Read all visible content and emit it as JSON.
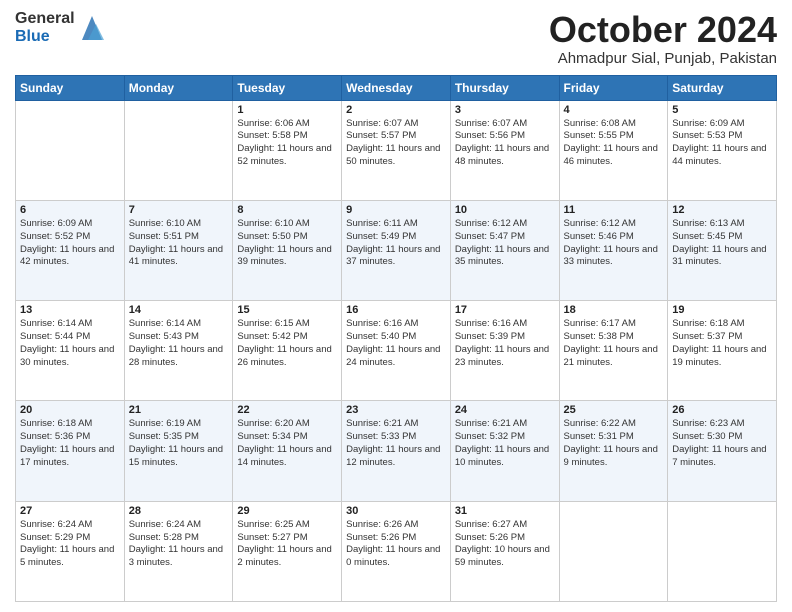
{
  "logo": {
    "line1": "General",
    "line2": "Blue"
  },
  "header": {
    "month": "October 2024",
    "location": "Ahmadpur Sial, Punjab, Pakistan"
  },
  "days_of_week": [
    "Sunday",
    "Monday",
    "Tuesday",
    "Wednesday",
    "Thursday",
    "Friday",
    "Saturday"
  ],
  "weeks": [
    [
      {
        "day": "",
        "sunrise": "",
        "sunset": "",
        "daylight": ""
      },
      {
        "day": "",
        "sunrise": "",
        "sunset": "",
        "daylight": ""
      },
      {
        "day": "1",
        "sunrise": "Sunrise: 6:06 AM",
        "sunset": "Sunset: 5:58 PM",
        "daylight": "Daylight: 11 hours and 52 minutes."
      },
      {
        "day": "2",
        "sunrise": "Sunrise: 6:07 AM",
        "sunset": "Sunset: 5:57 PM",
        "daylight": "Daylight: 11 hours and 50 minutes."
      },
      {
        "day": "3",
        "sunrise": "Sunrise: 6:07 AM",
        "sunset": "Sunset: 5:56 PM",
        "daylight": "Daylight: 11 hours and 48 minutes."
      },
      {
        "day": "4",
        "sunrise": "Sunrise: 6:08 AM",
        "sunset": "Sunset: 5:55 PM",
        "daylight": "Daylight: 11 hours and 46 minutes."
      },
      {
        "day": "5",
        "sunrise": "Sunrise: 6:09 AM",
        "sunset": "Sunset: 5:53 PM",
        "daylight": "Daylight: 11 hours and 44 minutes."
      }
    ],
    [
      {
        "day": "6",
        "sunrise": "Sunrise: 6:09 AM",
        "sunset": "Sunset: 5:52 PM",
        "daylight": "Daylight: 11 hours and 42 minutes."
      },
      {
        "day": "7",
        "sunrise": "Sunrise: 6:10 AM",
        "sunset": "Sunset: 5:51 PM",
        "daylight": "Daylight: 11 hours and 41 minutes."
      },
      {
        "day": "8",
        "sunrise": "Sunrise: 6:10 AM",
        "sunset": "Sunset: 5:50 PM",
        "daylight": "Daylight: 11 hours and 39 minutes."
      },
      {
        "day": "9",
        "sunrise": "Sunrise: 6:11 AM",
        "sunset": "Sunset: 5:49 PM",
        "daylight": "Daylight: 11 hours and 37 minutes."
      },
      {
        "day": "10",
        "sunrise": "Sunrise: 6:12 AM",
        "sunset": "Sunset: 5:47 PM",
        "daylight": "Daylight: 11 hours and 35 minutes."
      },
      {
        "day": "11",
        "sunrise": "Sunrise: 6:12 AM",
        "sunset": "Sunset: 5:46 PM",
        "daylight": "Daylight: 11 hours and 33 minutes."
      },
      {
        "day": "12",
        "sunrise": "Sunrise: 6:13 AM",
        "sunset": "Sunset: 5:45 PM",
        "daylight": "Daylight: 11 hours and 31 minutes."
      }
    ],
    [
      {
        "day": "13",
        "sunrise": "Sunrise: 6:14 AM",
        "sunset": "Sunset: 5:44 PM",
        "daylight": "Daylight: 11 hours and 30 minutes."
      },
      {
        "day": "14",
        "sunrise": "Sunrise: 6:14 AM",
        "sunset": "Sunset: 5:43 PM",
        "daylight": "Daylight: 11 hours and 28 minutes."
      },
      {
        "day": "15",
        "sunrise": "Sunrise: 6:15 AM",
        "sunset": "Sunset: 5:42 PM",
        "daylight": "Daylight: 11 hours and 26 minutes."
      },
      {
        "day": "16",
        "sunrise": "Sunrise: 6:16 AM",
        "sunset": "Sunset: 5:40 PM",
        "daylight": "Daylight: 11 hours and 24 minutes."
      },
      {
        "day": "17",
        "sunrise": "Sunrise: 6:16 AM",
        "sunset": "Sunset: 5:39 PM",
        "daylight": "Daylight: 11 hours and 23 minutes."
      },
      {
        "day": "18",
        "sunrise": "Sunrise: 6:17 AM",
        "sunset": "Sunset: 5:38 PM",
        "daylight": "Daylight: 11 hours and 21 minutes."
      },
      {
        "day": "19",
        "sunrise": "Sunrise: 6:18 AM",
        "sunset": "Sunset: 5:37 PM",
        "daylight": "Daylight: 11 hours and 19 minutes."
      }
    ],
    [
      {
        "day": "20",
        "sunrise": "Sunrise: 6:18 AM",
        "sunset": "Sunset: 5:36 PM",
        "daylight": "Daylight: 11 hours and 17 minutes."
      },
      {
        "day": "21",
        "sunrise": "Sunrise: 6:19 AM",
        "sunset": "Sunset: 5:35 PM",
        "daylight": "Daylight: 11 hours and 15 minutes."
      },
      {
        "day": "22",
        "sunrise": "Sunrise: 6:20 AM",
        "sunset": "Sunset: 5:34 PM",
        "daylight": "Daylight: 11 hours and 14 minutes."
      },
      {
        "day": "23",
        "sunrise": "Sunrise: 6:21 AM",
        "sunset": "Sunset: 5:33 PM",
        "daylight": "Daylight: 11 hours and 12 minutes."
      },
      {
        "day": "24",
        "sunrise": "Sunrise: 6:21 AM",
        "sunset": "Sunset: 5:32 PM",
        "daylight": "Daylight: 11 hours and 10 minutes."
      },
      {
        "day": "25",
        "sunrise": "Sunrise: 6:22 AM",
        "sunset": "Sunset: 5:31 PM",
        "daylight": "Daylight: 11 hours and 9 minutes."
      },
      {
        "day": "26",
        "sunrise": "Sunrise: 6:23 AM",
        "sunset": "Sunset: 5:30 PM",
        "daylight": "Daylight: 11 hours and 7 minutes."
      }
    ],
    [
      {
        "day": "27",
        "sunrise": "Sunrise: 6:24 AM",
        "sunset": "Sunset: 5:29 PM",
        "daylight": "Daylight: 11 hours and 5 minutes."
      },
      {
        "day": "28",
        "sunrise": "Sunrise: 6:24 AM",
        "sunset": "Sunset: 5:28 PM",
        "daylight": "Daylight: 11 hours and 3 minutes."
      },
      {
        "day": "29",
        "sunrise": "Sunrise: 6:25 AM",
        "sunset": "Sunset: 5:27 PM",
        "daylight": "Daylight: 11 hours and 2 minutes."
      },
      {
        "day": "30",
        "sunrise": "Sunrise: 6:26 AM",
        "sunset": "Sunset: 5:26 PM",
        "daylight": "Daylight: 11 hours and 0 minutes."
      },
      {
        "day": "31",
        "sunrise": "Sunrise: 6:27 AM",
        "sunset": "Sunset: 5:26 PM",
        "daylight": "Daylight: 10 hours and 59 minutes."
      },
      {
        "day": "",
        "sunrise": "",
        "sunset": "",
        "daylight": ""
      },
      {
        "day": "",
        "sunrise": "",
        "sunset": "",
        "daylight": ""
      }
    ]
  ]
}
